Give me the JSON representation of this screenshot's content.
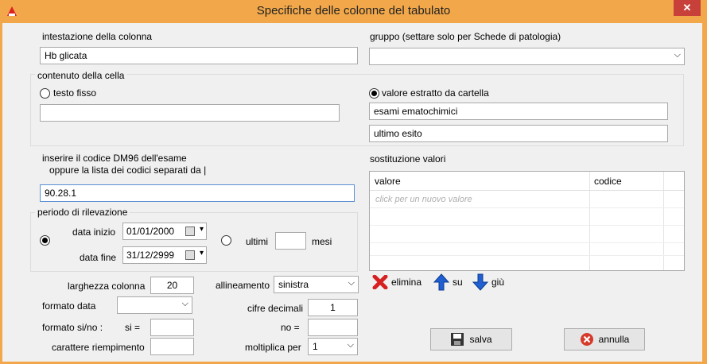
{
  "window": {
    "title": "Specifiche delle colonne del tabulato",
    "close_glyph": "✕"
  },
  "header": {
    "col_label": "intestazione della colonna",
    "col_value": "Hb glicata",
    "group_label": "gruppo (settare solo per Schede di patologia)",
    "group_value": ""
  },
  "contenuto": {
    "legend": "contenuto della cella",
    "fixed_label": "testo fisso",
    "fixed_value": "",
    "extracted_label": "valore estratto da cartella",
    "extracted_value1": "esami ematochimici",
    "extracted_value2": "ultimo esito"
  },
  "codice": {
    "label1": "inserire il codice DM96 dell'esame",
    "label2": "oppure la lista dei codici separati da |",
    "value": "90.28.1"
  },
  "periodo": {
    "legend": "periodo di rilevazione",
    "start_label": "data inizio",
    "start_value": "01/01/2000",
    "end_label": "data fine",
    "end_value": "31/12/2999",
    "last_label": "ultimi",
    "last_value": "",
    "months_label": "mesi"
  },
  "sostituzione": {
    "label": "sostituzione valori",
    "col_valore": "valore",
    "col_codice": "codice",
    "placeholder": "click per un nuovo valore"
  },
  "actions": {
    "delete": "elimina",
    "up": "su",
    "down": "giù"
  },
  "format": {
    "width_label": "larghezza colonna",
    "width_value": "20",
    "align_label": "allineamento",
    "align_value": "sinistra",
    "date_label": "formato data",
    "date_value": "",
    "decimals_label": "cifre decimali",
    "decimals_value": "1",
    "yesno_label": "formato si/no :",
    "si_label": "si  =",
    "si_value": "",
    "no_label": "no  =",
    "no_value": "",
    "fill_label": "carattere riempimento",
    "fill_value": "",
    "mult_label": "moltiplica per",
    "mult_value": "1"
  },
  "buttons": {
    "save": "salva",
    "cancel": "annulla"
  },
  "colors": {
    "titlebar": "#f2a84a",
    "close": "#c7413a",
    "client": "#f0f0f0"
  }
}
